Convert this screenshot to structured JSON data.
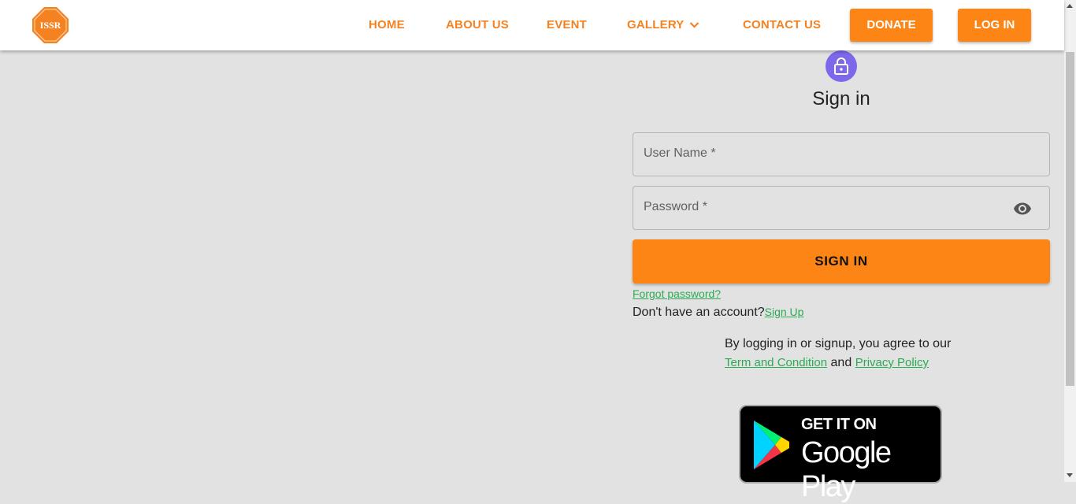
{
  "brand": {
    "logo_text": "ISSR",
    "accent_color": "#fd8515"
  },
  "nav": {
    "links": [
      {
        "label": "HOME"
      },
      {
        "label": "ABOUT US"
      },
      {
        "label": "EVENT"
      },
      {
        "label": "GALLERY"
      },
      {
        "label": "CONTACT US"
      }
    ],
    "donate_label": "DONATE",
    "login_label": "LOG IN"
  },
  "signin": {
    "title": "Sign in",
    "username_label": "User Name *",
    "password_label": "Password *",
    "submit_label": "SIGN IN",
    "forgot_label": "Forgot password?",
    "no_account_text": "Don't have an account?",
    "signup_label": "Sign Up",
    "terms_text": "By logging in or signup, you agree to our",
    "terms_link": "Term and Condition",
    "and_text": "and",
    "privacy_link": "Privacy Policy"
  },
  "store_badge": {
    "small": "GET IT ON",
    "big": "Google Play"
  }
}
